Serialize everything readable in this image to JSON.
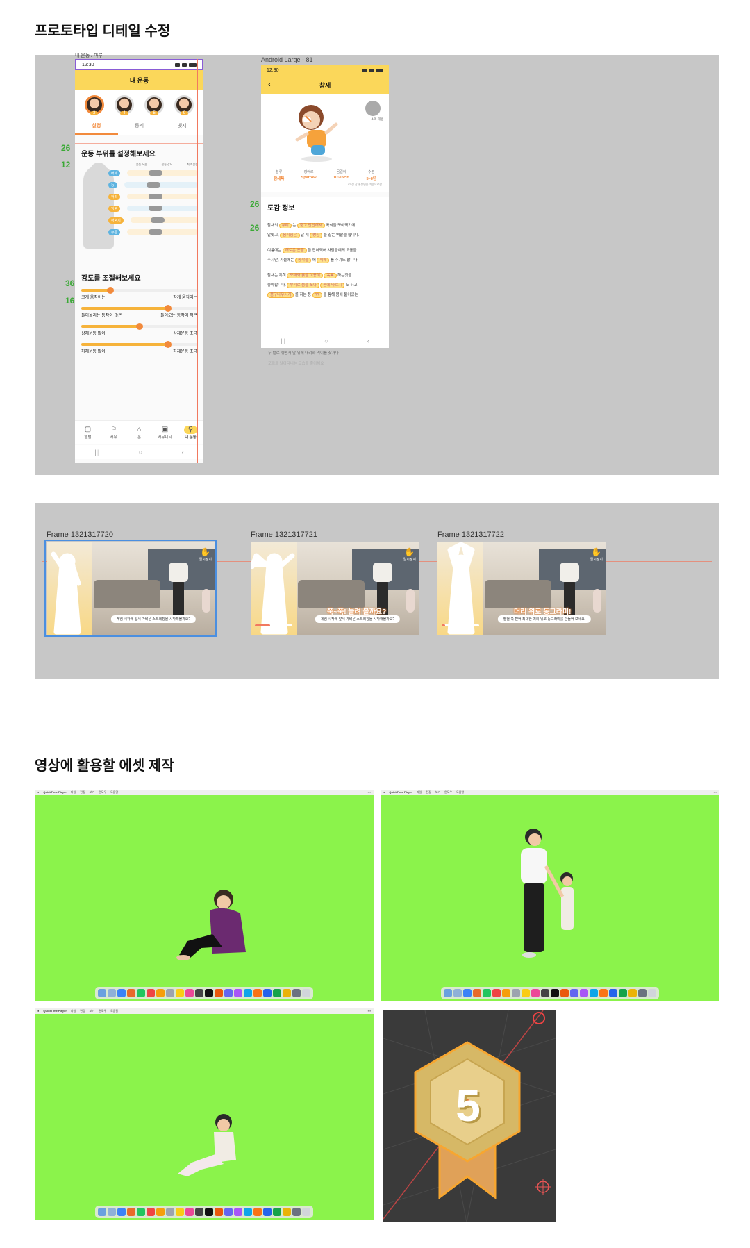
{
  "sections": {
    "prototype_title": "프로토타입 디테일 수정",
    "asset_title": "영상에 활용할 에셋 제작"
  },
  "phone1": {
    "frame_label": "내 운동 / 마루",
    "time": "12:30",
    "title": "내 운동",
    "avatars": [
      {
        "badge": "3"
      },
      {
        "badge": "4"
      },
      {
        "badge": "5"
      },
      {
        "badge": "9"
      }
    ],
    "tabs": [
      "설정",
      "통계",
      "뱃지"
    ],
    "heading1": "운동 부위를 설정해보세요",
    "legend": [
      "운동 노출",
      "운동 강도",
      "최고 운동"
    ],
    "parts": [
      {
        "label": "어깨",
        "color": "#5fb4e0"
      },
      {
        "label": "등",
        "color": "#5fb4e0"
      },
      {
        "label": "허리",
        "color": "#f6b33b"
      },
      {
        "label": "엉덩",
        "color": "#f6b33b"
      },
      {
        "label": "허벅지",
        "color": "#f6b33b"
      },
      {
        "label": "무릎",
        "color": "#5fb4e0"
      }
    ],
    "heading2": "강도를 조절해보세요",
    "sliders": [
      {
        "left": "크게 움직이는",
        "right": "작게 움직이는",
        "level": 0.25
      },
      {
        "left": "들어올리는 동작이 많은",
        "right": "들어오는 동작이 적은",
        "level": 0.75
      },
      {
        "left": "상체운동 많이",
        "right": "상체운동 조금",
        "level": 0.5
      },
      {
        "left": "하체운동 많이",
        "right": "하체운동 조금",
        "level": 0.75
      }
    ],
    "nav": [
      {
        "label": "앨범",
        "icon": "▢"
      },
      {
        "label": "커뮤",
        "icon": "⚐"
      },
      {
        "label": "홈",
        "icon": "⌂"
      },
      {
        "label": "커뮤니티",
        "icon": "▣"
      },
      {
        "label": "내 운동",
        "icon": "⚲"
      }
    ],
    "sysnav": [
      "|||",
      "○",
      "‹"
    ]
  },
  "guide_numbers": [
    "26",
    "12",
    "36",
    "16",
    "26",
    "26"
  ],
  "phone2": {
    "frame_label": "Android Large - 81",
    "time": "12:30",
    "title": "참새",
    "sound_label": "소리 재생",
    "info": [
      {
        "key": "분류",
        "value": "참새목"
      },
      {
        "key": "영어로",
        "value": "Sparrow"
      },
      {
        "key": "몸길이",
        "value": "10~15cm"
      },
      {
        "key": "수명",
        "value": "5~8년"
      }
    ],
    "info_note": "*야생 참새 성인을 기준으로함",
    "heading": "도감 정보",
    "lines": [
      {
        "a": "참새의 ",
        "h1": "부리",
        "b": " 는 ",
        "h2": "짧고 단단해서",
        "c": " 곡식을 쪼아먹기에"
      },
      {
        "a": "알맞고, ",
        "h1": "움직임은",
        "b": " 날 때 ",
        "h2": "방향",
        "c": " 을 잡는 역할을 합니다."
      },
      {
        "a": "여름에는 ",
        "h1": "해로운 곤충",
        "b": " 을 잡아먹어 사람들에게 도움을",
        "h2": "",
        "c": ""
      },
      {
        "a": "주지만, 가을에는 ",
        "h1": "농작물",
        "b": " 에 ",
        "h2": "피해",
        "c": " 를 주기도 합니다."
      },
      {
        "a": "참새는 특히 ",
        "h1": "모래와 흙을 이용해",
        "b": " ",
        "h2": "목욕",
        "c": " 하는것을"
      },
      {
        "a": "좋아합니다. ",
        "h1": "부리로 몸을 쪼아",
        "b": " ",
        "h2": "몸에 바르기",
        "c": " 도 하고"
      },
      {
        "a": "",
        "h1": "몸구나무서기",
        "b": " 를 하는 등 ",
        "h2": "??",
        "c": " 을 통해 몸에 붙어있는"
      }
    ],
    "overflow": [
      "두 발로 뛰면서 앞 위에 내려와 먹이를 찾거나",
      "포르르 날아다니는 모습을 좋아해요"
    ],
    "sysnav": [
      "|||",
      "○",
      "‹"
    ]
  },
  "game_frames": [
    {
      "label": "Frame 1321317720",
      "caption": "게임 시작에 앞서 가벼운 스트레칭을 시작해볼까요?",
      "big": "",
      "pause": "일시정지",
      "progress": 0
    },
    {
      "label": "Frame 1321317721",
      "caption": "게임 시작에 앞서 가벼운 스트레칭을 시작해볼까요?",
      "big": "쭉~쭉! 늘려 볼까요?",
      "pause": "일시정지",
      "progress": 0.4
    },
    {
      "label": "Frame 1321317722",
      "caption": "팔을 쭉 뻗어 최대한 머리 위로 동그라미를 만들어 보세요!",
      "big": "머리 위로 동그라미!",
      "pause": "일시정지",
      "progress": 0.1
    }
  ],
  "screenshots": [
    {
      "app": "QuickTime Player",
      "menus": [
        "파일",
        "편집",
        "보기",
        "윈도우",
        "도움말"
      ]
    },
    {
      "app": "QuickTime Player",
      "menus": [
        "파일",
        "편집",
        "보기",
        "윈도우",
        "도움말"
      ]
    },
    {
      "app": "QuickTime Player",
      "menus": [
        "파일",
        "편집",
        "보기",
        "윈도우",
        "도움말"
      ]
    }
  ],
  "medal": {
    "number": "5"
  },
  "colors": {
    "accent_yellow": "#fbd75a",
    "accent_orange": "#f28a3c",
    "chroma_green": "#8bf34b",
    "panel_grey": "#c7c7c7",
    "guide_green": "#3aa935"
  }
}
